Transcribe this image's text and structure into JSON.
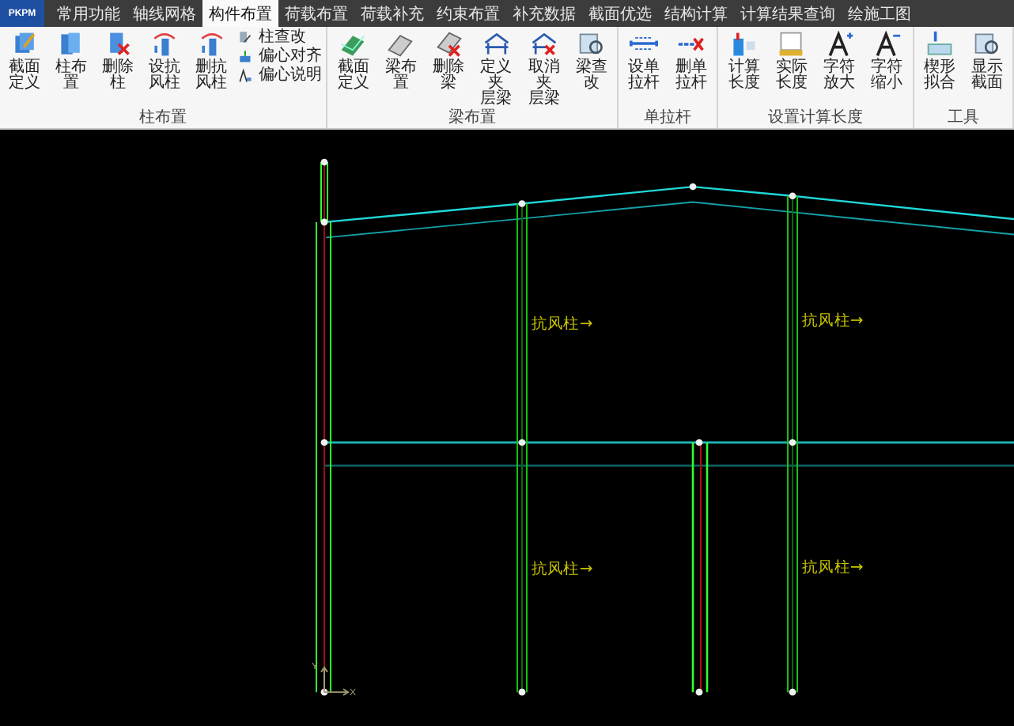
{
  "app_menu": {
    "label": "PKPM"
  },
  "tabs": [
    {
      "label": "常用功能",
      "selected": false
    },
    {
      "label": "轴线网格",
      "selected": false
    },
    {
      "label": "构件布置",
      "selected": true
    },
    {
      "label": "荷载布置",
      "selected": false
    },
    {
      "label": "荷载补充",
      "selected": false
    },
    {
      "label": "约束布置",
      "selected": false
    },
    {
      "label": "补充数据",
      "selected": false
    },
    {
      "label": "截面优选",
      "selected": false
    },
    {
      "label": "结构计算",
      "selected": false
    },
    {
      "label": "计算结果查询",
      "selected": false
    },
    {
      "label": "绘施工图",
      "selected": false
    }
  ],
  "groups": [
    {
      "title": "柱布置",
      "items": [
        {
          "kind": "large",
          "label": "截面定义"
        },
        {
          "kind": "large",
          "label": "柱布置"
        },
        {
          "kind": "large",
          "label": "删除柱"
        },
        {
          "kind": "large",
          "label": "设抗风柱"
        },
        {
          "kind": "large",
          "label": "删抗风柱"
        },
        {
          "kind": "stack",
          "entries": [
            {
              "label": "柱查改"
            },
            {
              "label": "偏心对齐"
            },
            {
              "label": "偏心说明"
            }
          ]
        }
      ]
    },
    {
      "title": "梁布置",
      "items": [
        {
          "kind": "large",
          "label": "截面定义"
        },
        {
          "kind": "large",
          "label": "梁布置"
        },
        {
          "kind": "large",
          "label": "删除梁"
        },
        {
          "kind": "large",
          "label": "定义夹层梁"
        },
        {
          "kind": "large",
          "label": "取消夹层梁"
        },
        {
          "kind": "large",
          "label": "梁查改"
        }
      ]
    },
    {
      "title": "单拉杆",
      "items": [
        {
          "kind": "large",
          "label": "设单拉杆"
        },
        {
          "kind": "large",
          "label": "删单拉杆"
        }
      ]
    },
    {
      "title": "设置计算长度",
      "items": [
        {
          "kind": "large",
          "label": "计算长度"
        },
        {
          "kind": "large",
          "label": "实际长度"
        },
        {
          "kind": "large",
          "label": "字符放大"
        },
        {
          "kind": "large",
          "label": "字符缩小"
        }
      ]
    },
    {
      "title": "工具",
      "items": [
        {
          "kind": "large",
          "label": "楔形拟合"
        },
        {
          "kind": "large",
          "label": "显示截面"
        }
      ]
    }
  ],
  "canvas": {
    "labels": [
      "抗风柱→",
      "抗风柱→",
      "抗风柱→",
      "抗风柱→"
    ],
    "axis_x": "X",
    "axis_y": "Y"
  }
}
